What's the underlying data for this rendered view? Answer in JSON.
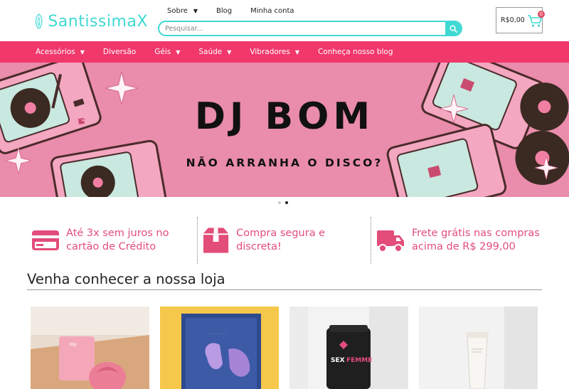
{
  "brand": {
    "logo_text": "SantissimaX"
  },
  "topnav": {
    "items": [
      {
        "label": "Sobre",
        "has_dropdown": true
      },
      {
        "label": "Blog",
        "has_dropdown": false
      },
      {
        "label": "Minha conta",
        "has_dropdown": false
      }
    ]
  },
  "search": {
    "placeholder": "Pesquisar..."
  },
  "cart": {
    "total": "R$0,00",
    "count": "0"
  },
  "menu": {
    "items": [
      {
        "label": "Acessórios",
        "has_dropdown": true
      },
      {
        "label": "Diversão",
        "has_dropdown": false
      },
      {
        "label": "Géis",
        "has_dropdown": true
      },
      {
        "label": "Saúde",
        "has_dropdown": true
      },
      {
        "label": "Vibradores",
        "has_dropdown": true
      },
      {
        "label": "Conheça nosso blog",
        "has_dropdown": false
      }
    ]
  },
  "banner": {
    "title": "DJ BOM",
    "subtitle": "NÃO ARRANHA O DISCO?"
  },
  "slider": {
    "slides": 2,
    "active": 2
  },
  "features": [
    {
      "icon": "credit-card-icon",
      "line1": "Até 3x sem juros no",
      "line2": "cartão de Crédito"
    },
    {
      "icon": "package-box-icon",
      "line1": "Compra segura e discreta!",
      "line2": ""
    },
    {
      "icon": "delivery-truck-icon",
      "line1": "Frete grátis nas compras",
      "line2": "acima de R$ 299,00"
    }
  ],
  "section": {
    "title": "Venha conhecer a nossa loja"
  },
  "products": [
    {
      "image": "pink-rose-toy-photo"
    },
    {
      "image": "purple-vibrator-box-photo"
    },
    {
      "image": "sex-femme-supplement-photo"
    },
    {
      "image": "cream-tube-photo"
    }
  ],
  "colors": {
    "accent_teal": "#3fd9d3",
    "menu_pink": "#f0386b",
    "banner_pink": "#ea8cab",
    "feature_pink": "#e24d7a"
  }
}
